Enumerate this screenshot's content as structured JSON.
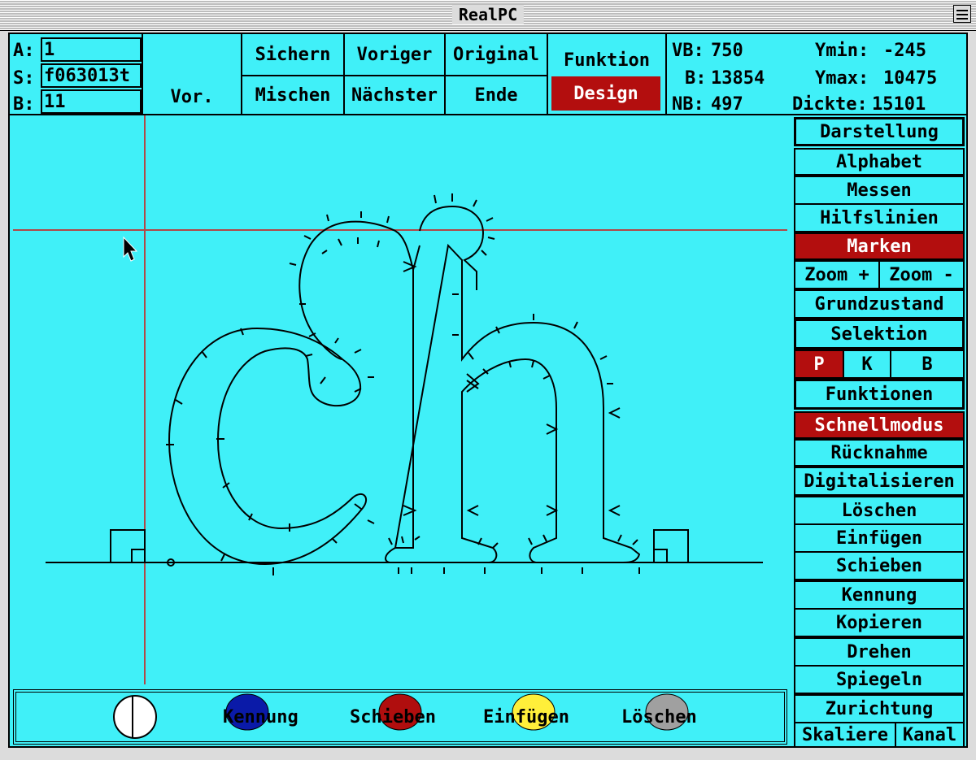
{
  "window": {
    "title": "RealPC"
  },
  "info": {
    "a_label": "A:",
    "a_value": "1",
    "s_label": "S:",
    "s_value": "f063013t",
    "b_label": "B:",
    "b_value": "11"
  },
  "toolbar": {
    "vor": "Vor.",
    "sichern": "Sichern",
    "mischen": "Mischen",
    "voriger": "Voriger",
    "naechster": "Nächster",
    "original": "Original",
    "ende": "Ende",
    "funktion": "Funktion",
    "design": "Design"
  },
  "metrics": {
    "vb_label": "VB:",
    "vb_value": "750",
    "b_label": "B:",
    "b_value": "13854",
    "nb_label": "NB:",
    "nb_value": "497",
    "ymin_label": "Ymin:",
    "ymin_value": "-245",
    "ymax_label": "Ymax:",
    "ymax_value": "10475",
    "dickte_label": "Dickte:",
    "dickte_value": "15101"
  },
  "sidebar": {
    "darstellung": "Darstellung",
    "alphabet": "Alphabet",
    "messen": "Messen",
    "hilfslinien": "Hilfslinien",
    "marken": "Marken",
    "zoom_plus": "Zoom +",
    "zoom_minus": "Zoom -",
    "grundzustand": "Grundzustand",
    "selektion": "Selektion",
    "sel_p": "P",
    "sel_k": "K",
    "sel_b": "B",
    "funktionen": "Funktionen",
    "schnellmodus": "Schnellmodus",
    "ruecknahme": "Rücknahme",
    "digitalisieren": "Digitalisieren",
    "loeschen": "Löschen",
    "einfuegen": "Einfügen",
    "schieben": "Schieben",
    "kennung": "Kennung",
    "kopieren": "Kopieren",
    "drehen": "Drehen",
    "spiegeln": "Spiegeln",
    "zurichtung": "Zurichtung",
    "skaliere": "Skaliere",
    "kanal": "Kanal"
  },
  "palette": {
    "kennung": "Kennung",
    "schieben": "Schieben",
    "einfuegen": "Einfügen",
    "loeschen": "Löschen",
    "colors": {
      "white": "#ffffff",
      "blue": "#0a1aa8",
      "red": "#b00e0e",
      "yellow": "#ffef3a",
      "gray": "#a0a0a0"
    }
  },
  "colors": {
    "screen_bg": "#40f0f8",
    "active": "#b30e0e",
    "guide": "#b04848"
  }
}
